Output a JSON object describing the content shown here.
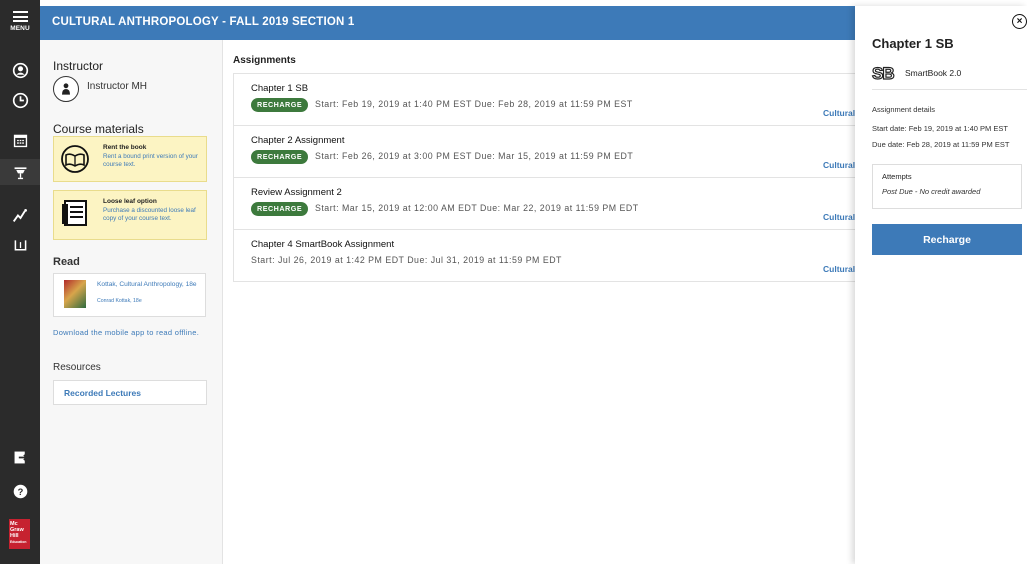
{
  "rail": {
    "menu_label": "MENU",
    "icons": [
      "user-circle-icon",
      "clock-icon",
      "calendar-icon",
      "presentation-icon",
      "insights-icon",
      "reader-icon",
      "exit-icon",
      "help-icon"
    ],
    "logo_lines": [
      "Mc",
      "Graw",
      "Hill",
      "Education"
    ]
  },
  "header": {
    "course_title": "CULTURAL ANTHROPOLOGY - FALL 2019 SECTION 1"
  },
  "left_panel": {
    "instructor_heading": "Instructor",
    "instructor_name": "Instructor MH",
    "course_materials_heading": "Course materials",
    "promos": [
      {
        "title": "Rent the book",
        "text": "Rent a bound print version of your course text."
      },
      {
        "title": "Loose leaf option",
        "text": "Purchase a discounted loose leaf copy of your course text."
      }
    ],
    "read_heading": "Read",
    "book": {
      "title": "Kottak, Cultural Anthropology, 18e",
      "author": "Conrad Kottak, 18e"
    },
    "mobile_link": "Download the mobile app to read offline.",
    "resources_heading": "Resources",
    "resources": [
      {
        "label": "Recorded Lectures"
      }
    ]
  },
  "assignments": {
    "heading": "Assignments",
    "items": [
      {
        "name": "Chapter 1 SB",
        "badge": "RECHARGE",
        "dates": "Start: Feb 19, 2019 at 1:40 PM EST  Due: Feb 28, 2019 at 11:59 PM EST",
        "tag": "Cultural"
      },
      {
        "name": "Chapter 2 Assignment",
        "badge": "RECHARGE",
        "dates": "Start: Feb 26, 2019 at 3:00 PM EST  Due: Mar 15, 2019 at 11:59 PM EDT",
        "tag": "Cultural"
      },
      {
        "name": "Review Assignment 2",
        "badge": "RECHARGE",
        "dates": "Start: Mar 15, 2019 at 12:00 AM EDT  Due: Mar 22, 2019 at 11:59 PM EDT",
        "tag": "Cultural"
      },
      {
        "name": "Chapter 4 SmartBook Assignment",
        "badge": "",
        "dates": "Start: Jul 26, 2019 at 1:42 PM EDT  Due: Jul 31, 2019 at 11:59 PM EDT",
        "tag": "Cultural"
      }
    ]
  },
  "detail": {
    "title": "Chapter 1 SB",
    "type_mark": "SB",
    "type_label": "SmartBook 2.0",
    "details_heading": "Assignment details",
    "start_label": "Start date:",
    "start_value": "Feb 19, 2019 at 1:40 PM EST",
    "due_label": "Due date:",
    "due_value": "Feb 28, 2019 at 11:59 PM EST",
    "attempts_title": "Attempts",
    "attempts_value": "Post Due - No credit awarded",
    "recharge_button": "Recharge"
  },
  "colors": {
    "header": "#3d7ab8",
    "rail": "#2b2b2b",
    "badge": "#3d7a3d",
    "promo": "#fcf4c3",
    "brand": "#c62230"
  }
}
